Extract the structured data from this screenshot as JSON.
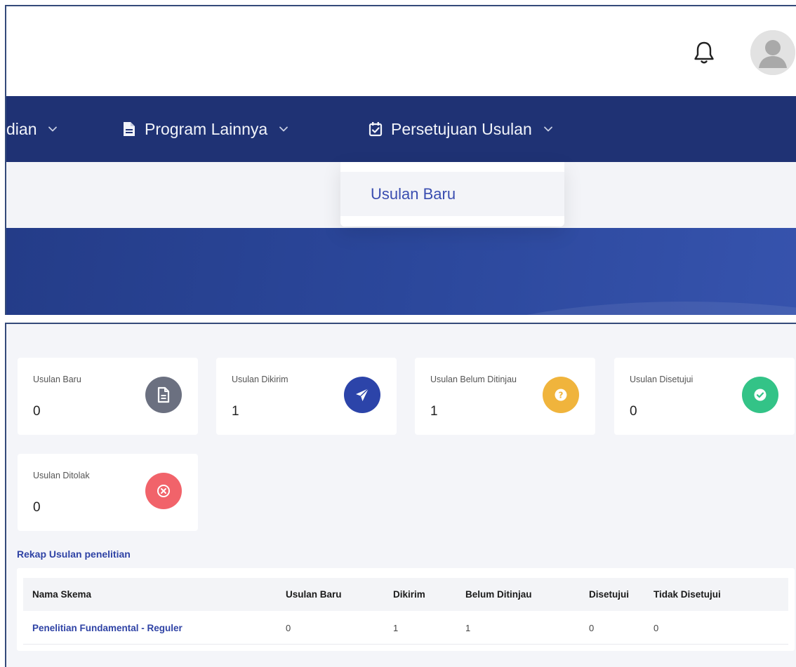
{
  "header": {
    "bell_icon": "bell-icon",
    "avatar_icon": "user-avatar"
  },
  "nav": {
    "items": [
      {
        "label": "dian",
        "icon": "",
        "has_chevron": true
      },
      {
        "label": "Program Lainnya",
        "icon": "file-text-icon",
        "has_chevron": true
      },
      {
        "label": "Persetujuan Usulan",
        "icon": "calendar-check-icon",
        "has_chevron": true
      }
    ],
    "dropdown_items": [
      {
        "label": "Usulan Baru"
      }
    ]
  },
  "stats": [
    {
      "label": "Usulan Baru",
      "value": "0",
      "icon": "file-icon",
      "color": "#6b7080"
    },
    {
      "label": "Usulan Dikirim",
      "value": "1",
      "icon": "paper-plane-icon",
      "color": "#2c44a9"
    },
    {
      "label": "Usulan Belum Ditinjau",
      "value": "1",
      "icon": "question-icon",
      "color": "#f0b43c"
    },
    {
      "label": "Usulan Disetujui",
      "value": "0",
      "icon": "check-icon",
      "color": "#33c387"
    },
    {
      "label": "Usulan Ditolak",
      "value": "0",
      "icon": "x-circle-icon",
      "color": "#f1636a"
    }
  ],
  "recap": {
    "title": "Rekap Usulan penelitian",
    "columns": [
      "Nama Skema",
      "Usulan Baru",
      "Dikirim",
      "Belum Ditinjau",
      "Disetujui",
      "Tidak Disetujui"
    ],
    "rows": [
      [
        "Penelitian Fundamental - Reguler",
        "0",
        "1",
        "1",
        "0",
        "0"
      ]
    ]
  },
  "colors": {
    "navbar": "#1f3274",
    "accent": "#2f43a5",
    "page_bg": "#f4f5f9"
  }
}
